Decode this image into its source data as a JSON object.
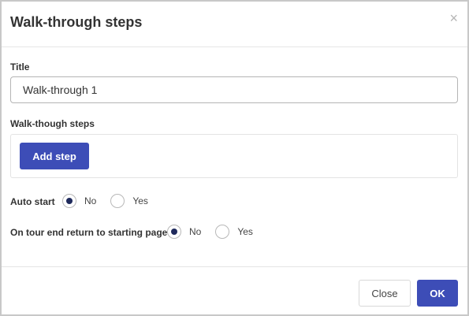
{
  "dialog": {
    "title": "Walk-through steps",
    "close_icon": "×"
  },
  "form": {
    "title_label": "Title",
    "title_value": "Walk-through 1",
    "steps_label": "Walk-though steps",
    "add_step_label": "Add step",
    "auto_start": {
      "label": "Auto start",
      "options": [
        "No",
        "Yes"
      ],
      "selected": "No"
    },
    "tour_end": {
      "label": "On tour end return to starting page",
      "options": [
        "No",
        "Yes"
      ],
      "selected": "No"
    }
  },
  "footer": {
    "close_label": "Close",
    "ok_label": "OK"
  },
  "colors": {
    "primary": "#3d4db7",
    "radio_checked": "#1f2a5c"
  }
}
